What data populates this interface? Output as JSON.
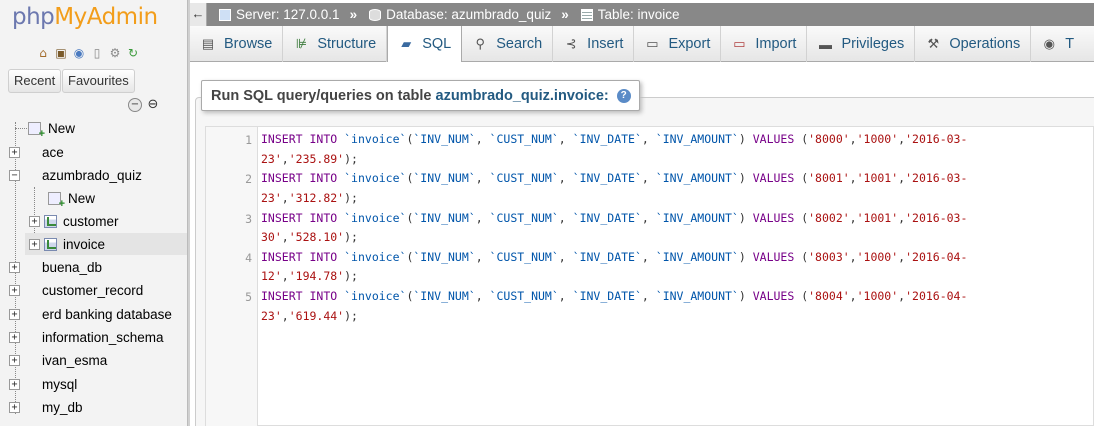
{
  "logo": {
    "part1": "php",
    "part2": "MyAdmin"
  },
  "nav": {
    "recent_label": "Recent",
    "favourites_label": "Favourites",
    "tree": {
      "new_root": "New",
      "databases": [
        {
          "name": "ace",
          "expanded": false
        },
        {
          "name": "azumbrado_quiz",
          "expanded": true,
          "children": [
            {
              "name": "New",
              "type": "new"
            },
            {
              "name": "customer",
              "type": "table"
            },
            {
              "name": "invoice",
              "type": "table",
              "selected": true
            }
          ]
        },
        {
          "name": "buena_db",
          "expanded": false
        },
        {
          "name": "customer_record",
          "expanded": false
        },
        {
          "name": "erd banking database",
          "expanded": false
        },
        {
          "name": "information_schema",
          "expanded": false
        },
        {
          "name": "ivan_esma",
          "expanded": false
        },
        {
          "name": "mysql",
          "expanded": false
        },
        {
          "name": "my_db",
          "expanded": false
        }
      ]
    }
  },
  "breadcrumb": {
    "server": "Server: 127.0.0.1",
    "database": "Database: azumbrado_quiz",
    "table": "Table: invoice",
    "separator": "»"
  },
  "menu": {
    "tabs": [
      {
        "label": "Browse",
        "icon": "browse-icon",
        "active": false
      },
      {
        "label": "Structure",
        "icon": "structure-icon",
        "active": false
      },
      {
        "label": "SQL",
        "icon": "sql-icon",
        "active": true
      },
      {
        "label": "Search",
        "icon": "search-icon",
        "active": false
      },
      {
        "label": "Insert",
        "icon": "insert-icon",
        "active": false
      },
      {
        "label": "Export",
        "icon": "export-icon",
        "active": false
      },
      {
        "label": "Import",
        "icon": "import-icon",
        "active": false
      },
      {
        "label": "Privileges",
        "icon": "privileges-icon",
        "active": false
      },
      {
        "label": "Operations",
        "icon": "operations-icon",
        "active": false
      },
      {
        "label": "T",
        "icon": "tracking-icon",
        "active": false
      }
    ]
  },
  "sql": {
    "legend_prefix": "Run SQL query/queries on table",
    "legend_table": "azumbrado_quiz.invoice:",
    "lines": [
      {
        "num": "1",
        "values": [
          "'8000'",
          "'1000'",
          "'2016-03-",
          "23'",
          "'235.89'"
        ]
      },
      {
        "num": "2",
        "values": [
          "'8001'",
          "'1001'",
          "'2016-03-",
          "23'",
          "'312.82'"
        ]
      },
      {
        "num": "3",
        "values": [
          "'8002'",
          "'1001'",
          "'2016-03-",
          "30'",
          "'528.10'"
        ]
      },
      {
        "num": "4",
        "values": [
          "'8003'",
          "'1000'",
          "'2016-04-",
          "12'",
          "'194.78'"
        ]
      },
      {
        "num": "5",
        "values": [
          "'8004'",
          "'1000'",
          "'2016-04-",
          "23'",
          "'619.44'"
        ]
      }
    ],
    "statement_head": {
      "insert": "INSERT",
      "into": "INTO",
      "table": "`invoice`",
      "columns": [
        "`INV_NUM`",
        "`CUST_NUM`",
        "`INV_DATE`",
        "`INV_AMOUNT`"
      ],
      "values_kw": "VALUES"
    }
  },
  "colors": {
    "keyword": "#770088",
    "identifier": "#0055aa",
    "string": "#aa1111",
    "link": "#235a81",
    "logo_php": "#6c78af",
    "logo_myadmin": "#f29d1a"
  }
}
